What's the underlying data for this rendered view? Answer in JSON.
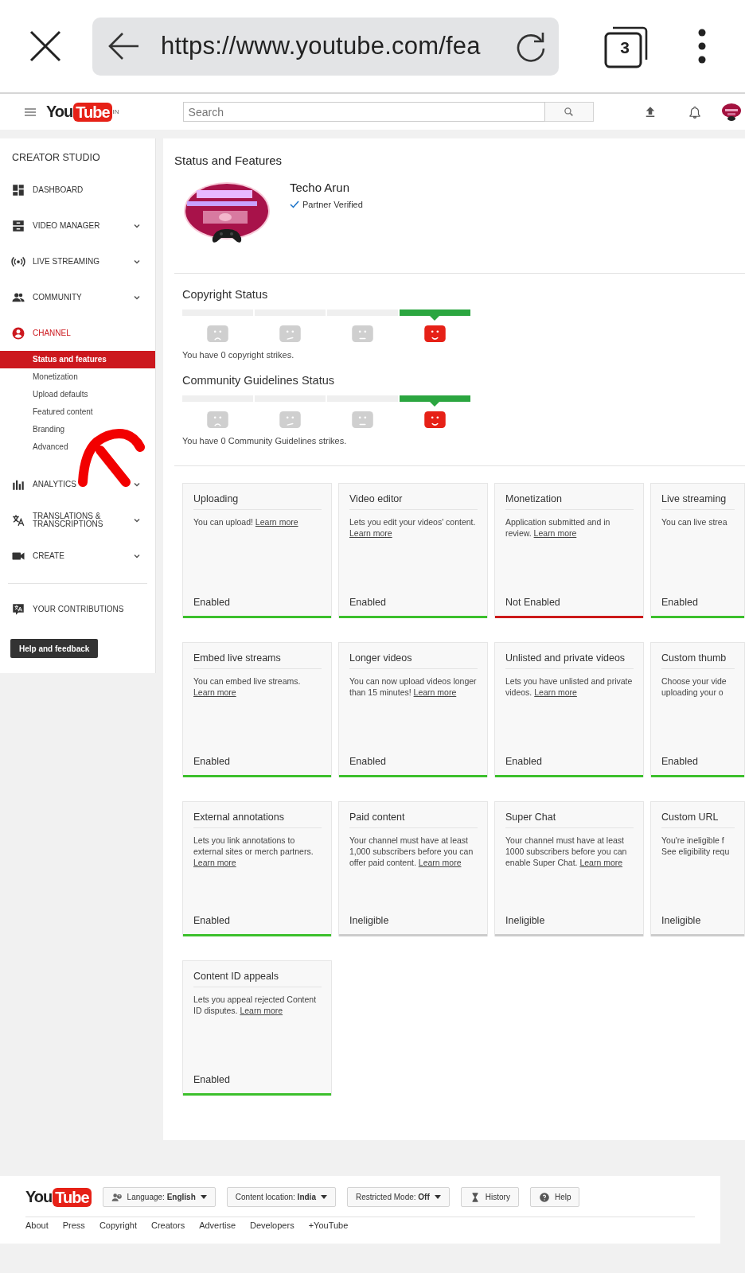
{
  "browser": {
    "url": "https://www.youtube.com/fea",
    "tab_count": "3"
  },
  "header": {
    "logo": {
      "you": "You",
      "tube": "Tube"
    },
    "region": "IN",
    "search": {
      "placeholder": "Search"
    }
  },
  "sidebar": {
    "title": "CREATOR STUDIO",
    "items": [
      {
        "label": "DASHBOARD",
        "expandable": false,
        "selected": false
      },
      {
        "label": "VIDEO MANAGER",
        "expandable": true,
        "selected": false
      },
      {
        "label": "LIVE STREAMING",
        "expandable": true,
        "selected": false
      },
      {
        "label": "COMMUNITY",
        "expandable": true,
        "selected": false
      },
      {
        "label": "CHANNEL",
        "expandable": false,
        "selected": true,
        "children": [
          {
            "label": "Status and features",
            "selected": true
          },
          {
            "label": "Monetization",
            "selected": false
          },
          {
            "label": "Upload defaults",
            "selected": false
          },
          {
            "label": "Featured content",
            "selected": false
          },
          {
            "label": "Branding",
            "selected": false
          },
          {
            "label": "Advanced",
            "selected": false
          }
        ]
      },
      {
        "label": "ANALYTICS",
        "expandable": true,
        "selected": false
      },
      {
        "label": "TRANSLATIONS & TRANSCRIPTIONS",
        "expandable": true,
        "selected": false
      },
      {
        "label": "CREATE",
        "expandable": true,
        "selected": false
      }
    ],
    "contributions": "YOUR CONTRIBUTIONS",
    "help_button": "Help and feedback"
  },
  "page": {
    "title": "Status and Features",
    "channel": {
      "name": "Techo Arun",
      "badge": "Partner Verified"
    },
    "statuses": [
      {
        "title": "Copyright Status",
        "faces": [
          {
            "selected": false
          },
          {
            "selected": false
          },
          {
            "selected": false
          },
          {
            "selected": true
          }
        ],
        "message": "You have 0 copyright strikes."
      },
      {
        "title": "Community Guidelines Status",
        "faces": [
          {
            "selected": false
          },
          {
            "selected": false
          },
          {
            "selected": false
          },
          {
            "selected": true
          }
        ],
        "message": "You have 0 Community Guidelines strikes."
      }
    ],
    "cards": [
      {
        "title": "Uploading",
        "description": "You can upload!",
        "link": "Learn more",
        "status": "Enabled",
        "color": "#3cc02c"
      },
      {
        "title": "Video editor",
        "description": "Lets you edit your videos' content.",
        "link": "Learn more",
        "status": "Enabled",
        "color": "#3cc02c"
      },
      {
        "title": "Monetization",
        "description": "Application submitted and in review.",
        "link": "Learn more",
        "status": "Not Enabled",
        "color": "#cc1a1a"
      },
      {
        "title": "Live streaming",
        "lines": [
          "You can live strea"
        ],
        "status": "Enabled",
        "color": "#3cc02c"
      },
      {
        "title": "Embed live streams",
        "description": "You can embed live streams.",
        "link": "Learn more",
        "status": "Enabled",
        "color": "#3cc02c"
      },
      {
        "title": "Longer videos",
        "description": "You can now upload videos longer than 15 minutes!",
        "link": "Learn more",
        "status": "Enabled",
        "color": "#3cc02c"
      },
      {
        "title": "Unlisted and private videos",
        "description": "Lets you have unlisted and private videos.",
        "link": "Learn more",
        "status": "Enabled",
        "color": "#3cc02c"
      },
      {
        "title": "Custom thumb",
        "lines": [
          "Choose your vide",
          "uploading your o"
        ],
        "status": "Enabled",
        "color": "#3cc02c"
      },
      {
        "title": "External annotations",
        "description": "Lets you link annotations to external sites or merch partners.",
        "link": "Learn more",
        "status": "Enabled",
        "color": "#3cc02c"
      },
      {
        "title": "Paid content",
        "description": "Your channel must have at least 1,000 subscribers before you can offer paid content.",
        "link": "Learn more",
        "status": "Ineligible",
        "color": "#cccccc"
      },
      {
        "title": "Super Chat",
        "description": "Your channel must have at least 1000 subscribers before you can enable Super Chat.",
        "link": "Learn more",
        "status": "Ineligible",
        "color": "#cccccc"
      },
      {
        "title": "Custom URL",
        "lines": [
          "You're ineligible f",
          "See eligibility requ"
        ],
        "status": "Ineligible",
        "color": "#cccccc"
      },
      {
        "title": "Content ID appeals",
        "description": "Lets you appeal rejected Content ID disputes.",
        "link": "Learn more",
        "status": "Enabled",
        "color": "#3cc02c"
      }
    ]
  },
  "footer": {
    "logo": {
      "you": "You",
      "tube": "Tube"
    },
    "buttons": [
      {
        "label": "Language: **English**",
        "dropdown": true
      },
      {
        "label": "Content location: **India**",
        "dropdown": true
      },
      {
        "label": "Restricted Mode: **Off**",
        "dropdown": true
      },
      {
        "label": "History",
        "dropdown": false
      },
      {
        "label": "Help",
        "dropdown": false
      }
    ],
    "links": [
      "About",
      "Press",
      "Copyright",
      "Creators",
      "Advertise",
      "Developers",
      "+YouTube"
    ]
  }
}
